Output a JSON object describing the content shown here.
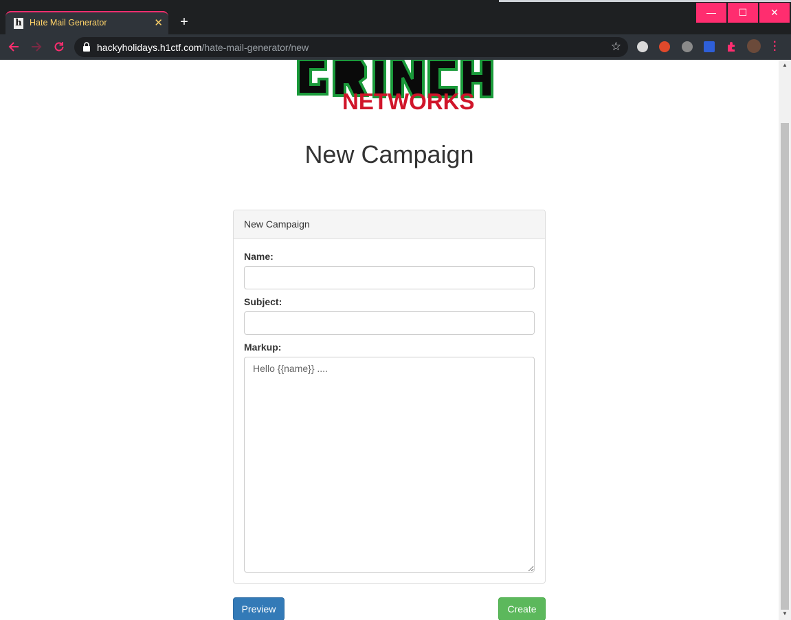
{
  "browser": {
    "tab_title": "Hate Mail Generator",
    "tab_favicon_char": "h",
    "tab_close": "✕",
    "new_tab": "+",
    "url_host": "hackyholidays.h1ctf.com",
    "url_path": "/hate-mail-generator/new",
    "window_controls": {
      "minimize": "—",
      "maximize": "☐",
      "close": "✕"
    },
    "accent_color": "#ff2d6f",
    "tab_text_color": "#ffd369",
    "icons": [
      "back-icon",
      "forward-icon",
      "reload-icon",
      "lock-icon",
      "star-icon",
      "extensions-icon",
      "profile-avatar",
      "menu-icon"
    ]
  },
  "page": {
    "logo_text": "NETWORKS",
    "title": "New Campaign",
    "panel": {
      "heading": "New Campaign",
      "name_label": "Name:",
      "name_value": "",
      "subject_label": "Subject:",
      "subject_value": "",
      "markup_label": "Markup:",
      "markup_placeholder": "Hello {{name}} ...."
    },
    "buttons": {
      "preview": "Preview",
      "create": "Create"
    },
    "colors": {
      "preview": "#337ab7",
      "create": "#5cb85c",
      "logo_red": "#d0152a",
      "logo_green": "#1a9a3a"
    }
  }
}
